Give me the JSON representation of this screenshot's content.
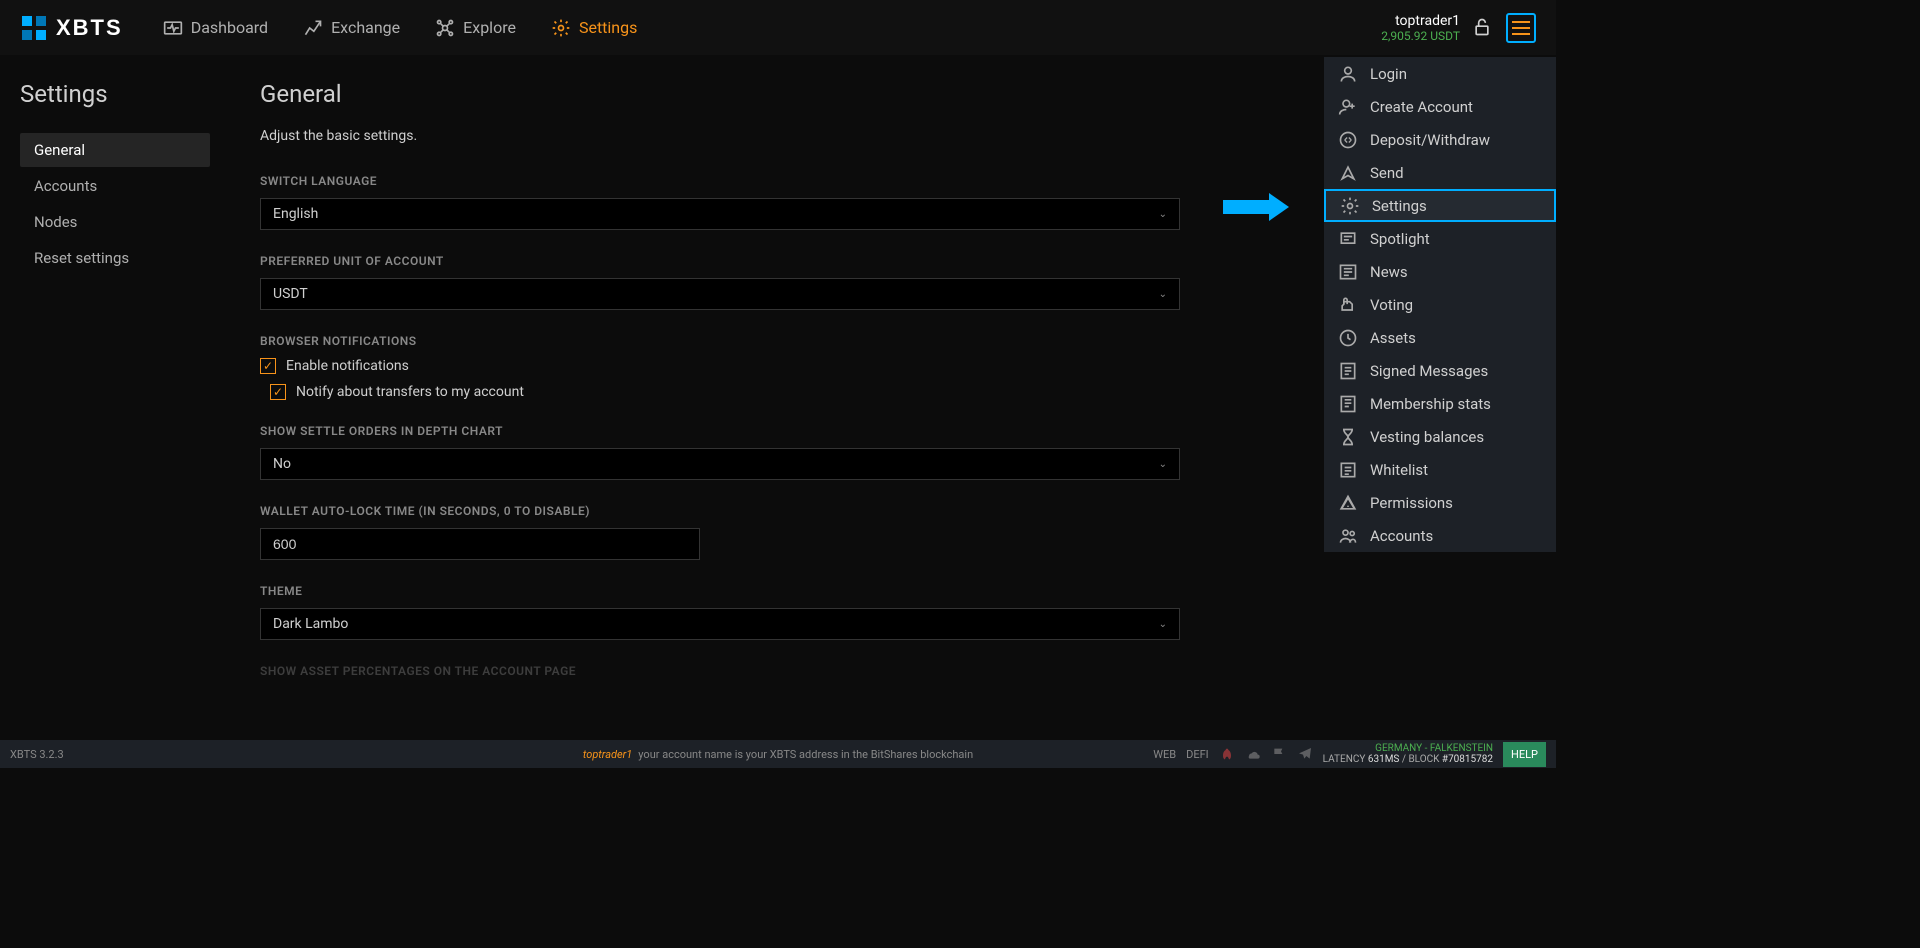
{
  "header": {
    "logo_text": "XBTS",
    "nav": [
      {
        "label": "Dashboard"
      },
      {
        "label": "Exchange"
      },
      {
        "label": "Explore"
      },
      {
        "label": "Settings"
      }
    ],
    "account_name": "toptrader1",
    "account_balance": "2,905.92 USDT"
  },
  "dropdown": {
    "items": [
      {
        "label": "Login"
      },
      {
        "label": "Create Account"
      },
      {
        "label": "Deposit/Withdraw"
      },
      {
        "label": "Send"
      },
      {
        "label": "Settings"
      },
      {
        "label": "Spotlight"
      },
      {
        "label": "News"
      },
      {
        "label": "Voting"
      },
      {
        "label": "Assets"
      },
      {
        "label": "Signed Messages"
      },
      {
        "label": "Membership stats"
      },
      {
        "label": "Vesting balances"
      },
      {
        "label": "Whitelist"
      },
      {
        "label": "Permissions"
      },
      {
        "label": "Accounts"
      }
    ]
  },
  "sidebar": {
    "title": "Settings",
    "items": [
      {
        "label": "General"
      },
      {
        "label": "Accounts"
      },
      {
        "label": "Nodes"
      },
      {
        "label": "Reset settings"
      }
    ]
  },
  "main": {
    "title": "General",
    "description": "Adjust the basic settings.",
    "language_label": "SWITCH LANGUAGE",
    "language_value": "English",
    "unit_label": "PREFERRED UNIT OF ACCOUNT",
    "unit_value": "USDT",
    "notifications_label": "BROWSER NOTIFICATIONS",
    "enable_notifications": "Enable notifications",
    "notify_transfers": "Notify about transfers to my account",
    "settle_label": "SHOW SETTLE ORDERS IN DEPTH CHART",
    "settle_value": "No",
    "autolock_label": "WALLET AUTO-LOCK TIME (IN SECONDS, 0 TO DISABLE)",
    "autolock_value": "600",
    "theme_label": "THEME",
    "theme_value": "Dark Lambo",
    "asset_percentages_label": "SHOW ASSET PERCENTAGES ON THE ACCOUNT PAGE"
  },
  "footer": {
    "version": "XBTS 3.2.3",
    "user": "toptrader1",
    "message": "your account name is your XBTS address in the BitShares blockchain",
    "web": "WEB",
    "defi": "DEFI",
    "node_location": "GERMANY - FALKENSTEIN",
    "latency_label": "LATENCY",
    "latency_value": "631MS",
    "block_label": "BLOCK",
    "block_value": "#70815782",
    "help": "HELP"
  }
}
